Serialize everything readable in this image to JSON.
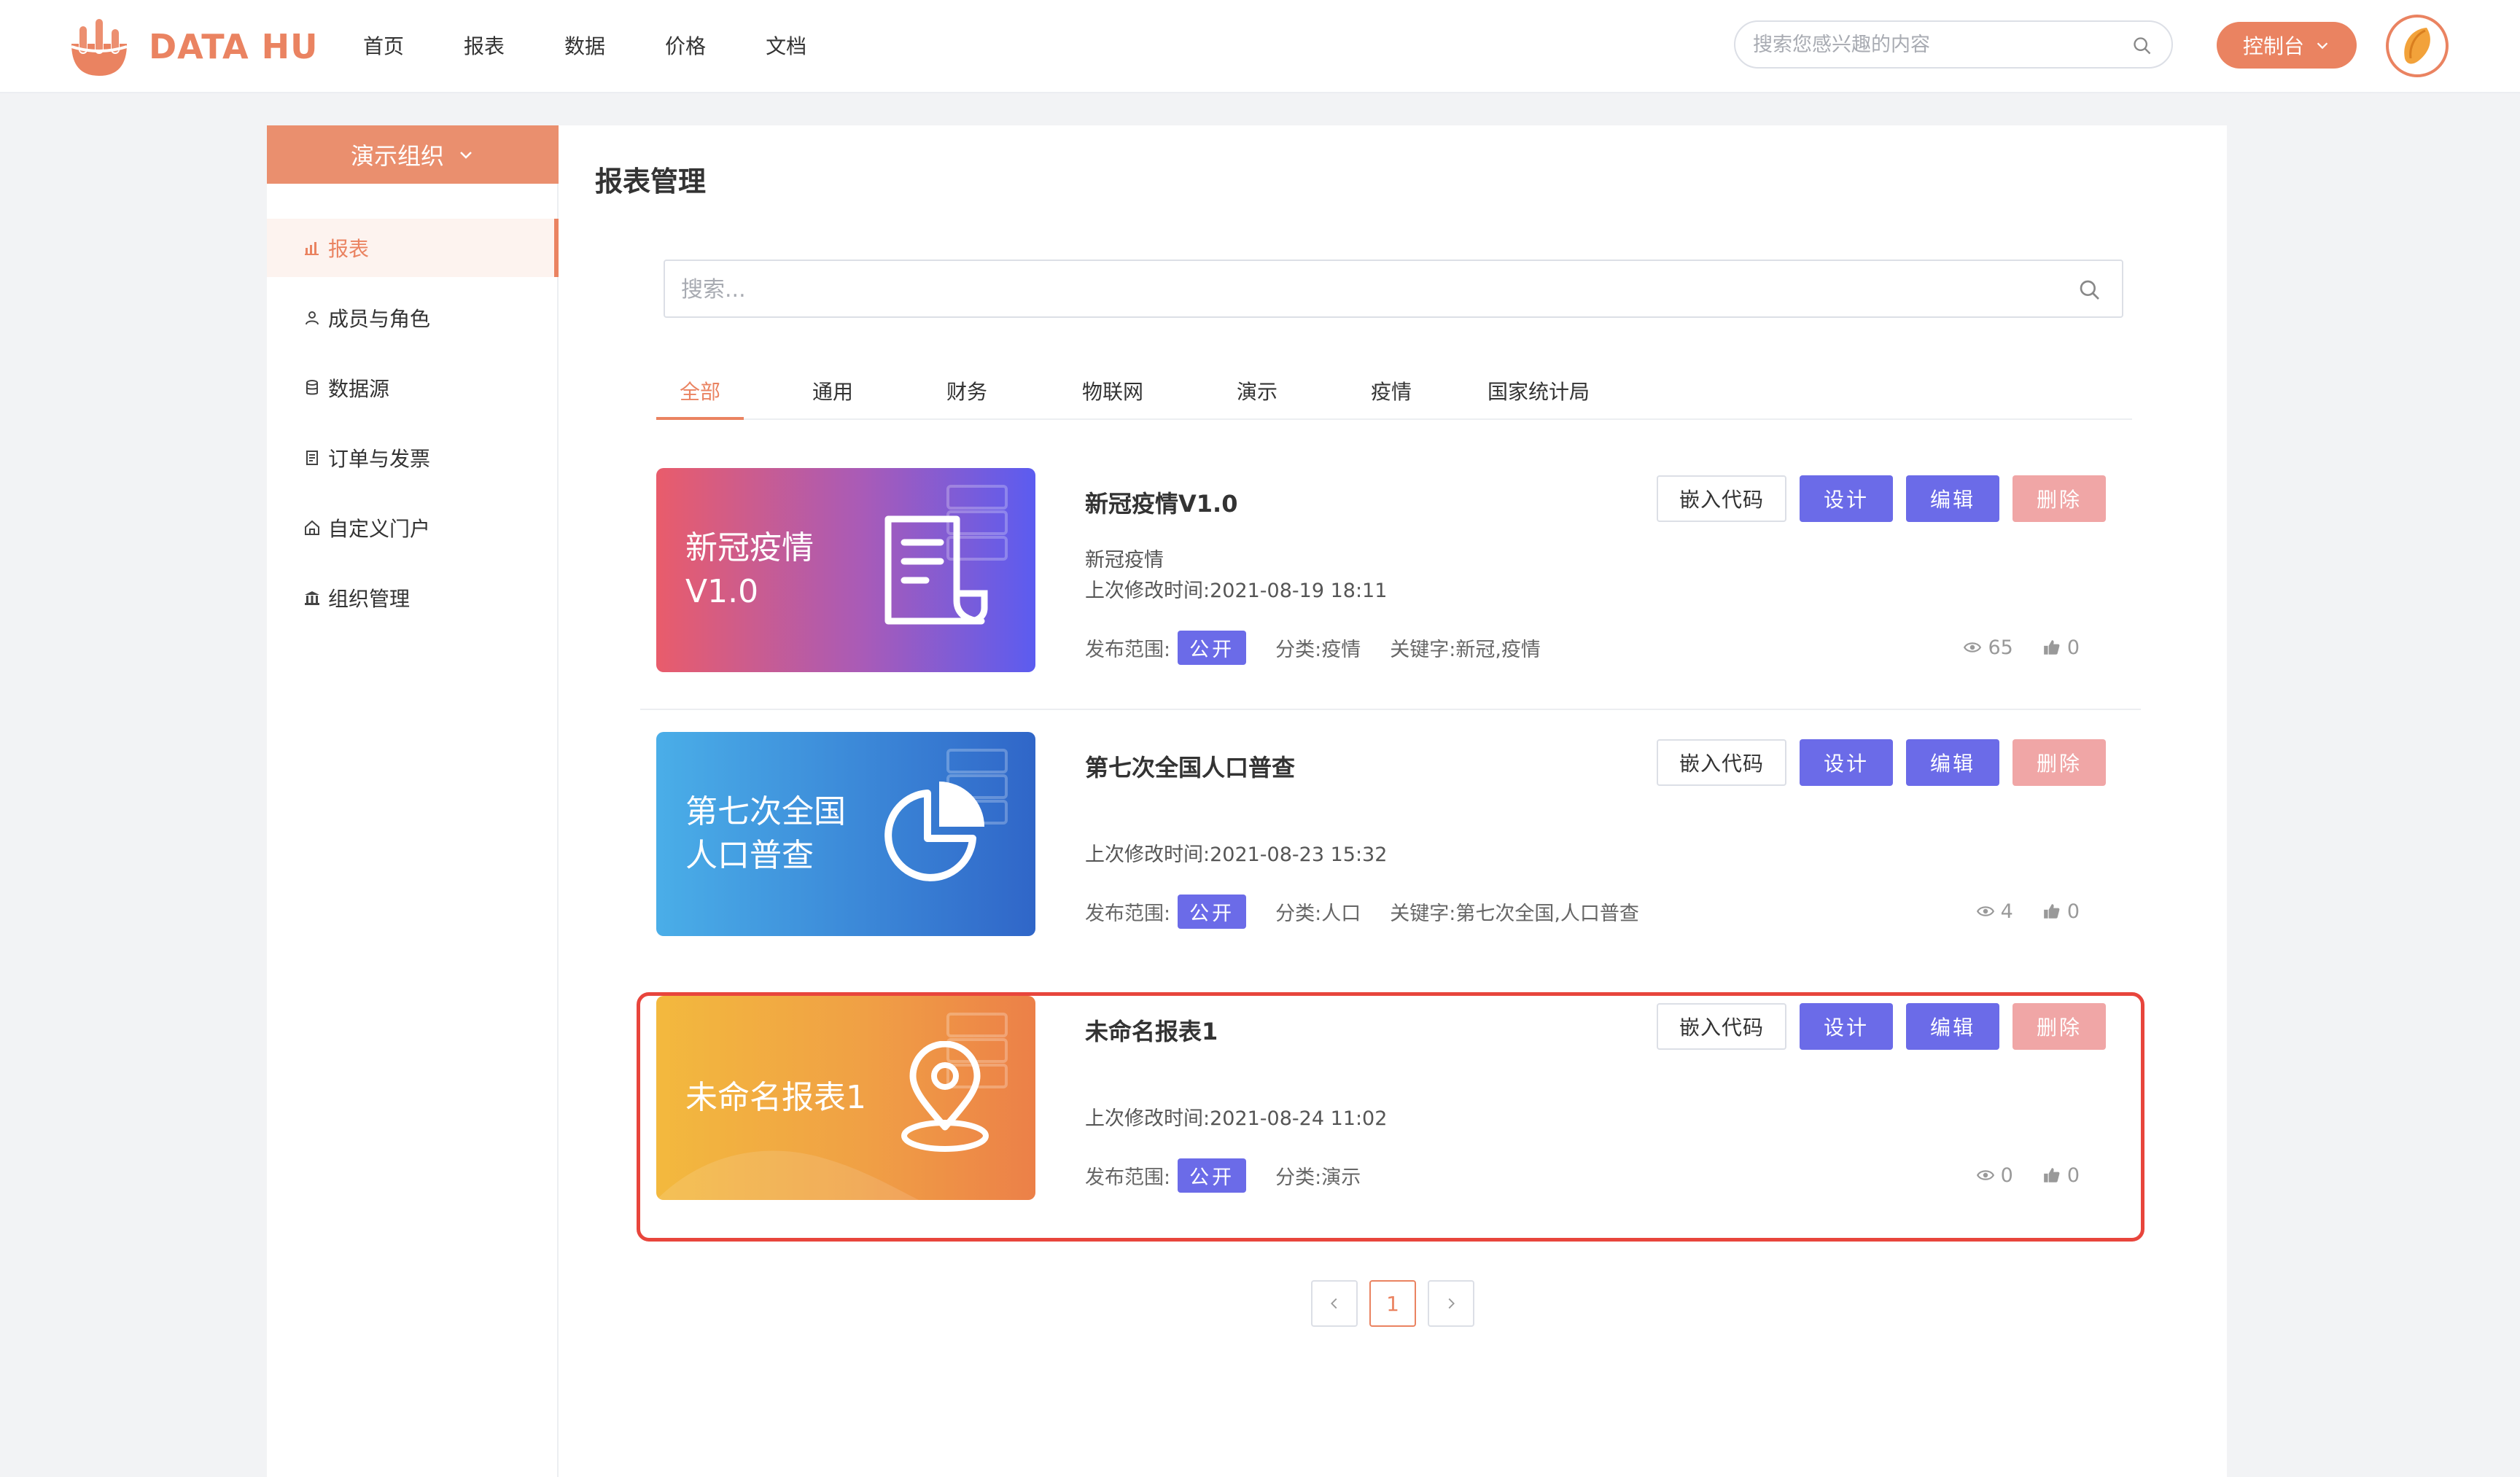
{
  "brand": {
    "name": "DATA HU",
    "color": "#ea8361"
  },
  "nav": {
    "items": [
      "首页",
      "报表",
      "数据",
      "价格",
      "文档"
    ]
  },
  "top_search": {
    "placeholder": "搜索您感兴趣的内容"
  },
  "console_button": {
    "label": "控制台"
  },
  "sidebar": {
    "org_label": "演示组织",
    "items": [
      {
        "label": "报表",
        "icon": "bar-chart-icon",
        "active": true
      },
      {
        "label": "成员与角色",
        "icon": "user-icon",
        "active": false
      },
      {
        "label": "数据源",
        "icon": "database-icon",
        "active": false
      },
      {
        "label": "订单与发票",
        "icon": "receipt-icon",
        "active": false
      },
      {
        "label": "自定义门户",
        "icon": "home-icon",
        "active": false
      },
      {
        "label": "组织管理",
        "icon": "bank-icon",
        "active": false
      }
    ]
  },
  "main": {
    "title": "报表管理",
    "search_placeholder": "搜索...",
    "tabs": [
      "全部",
      "通用",
      "财务",
      "物联网",
      "演示",
      "疫情",
      "国家统计局"
    ],
    "active_tab": 0
  },
  "labels": {
    "publish_scope": "发布范围:",
    "category": "分类:",
    "keywords": "关键字:",
    "embed": "嵌入代码",
    "design": "设计",
    "edit": "编辑",
    "delete": "删除",
    "public": "公开"
  },
  "reports": [
    {
      "thumb_lines": [
        "新冠疫情",
        "V1.0"
      ],
      "title": "新冠疫情V1.0",
      "description": "新冠疫情",
      "modified": "上次修改时间:2021-08-19 18:11",
      "category": "疫情",
      "keywords": "新冠,疫情",
      "views": "65",
      "likes": "0",
      "thumb_icon": "document-icon"
    },
    {
      "thumb_lines": [
        "第七次全国",
        "人口普查"
      ],
      "title": "第七次全国人口普查",
      "description": "",
      "modified": "上次修改时间:2021-08-23 15:32",
      "category": "人口",
      "keywords": "第七次全国,人口普查",
      "views": "4",
      "likes": "0",
      "thumb_icon": "pie-chart-icon"
    },
    {
      "thumb_lines": [
        "未命名报表1"
      ],
      "title": "未命名报表1",
      "description": "",
      "modified": "上次修改时间:2021-08-24 11:02",
      "category": "演示",
      "keywords": "",
      "views": "0",
      "likes": "0",
      "thumb_icon": "map-pin-icon",
      "highlighted": true
    }
  ],
  "pagination": {
    "prev": "<",
    "current": "1",
    "next": ">"
  }
}
